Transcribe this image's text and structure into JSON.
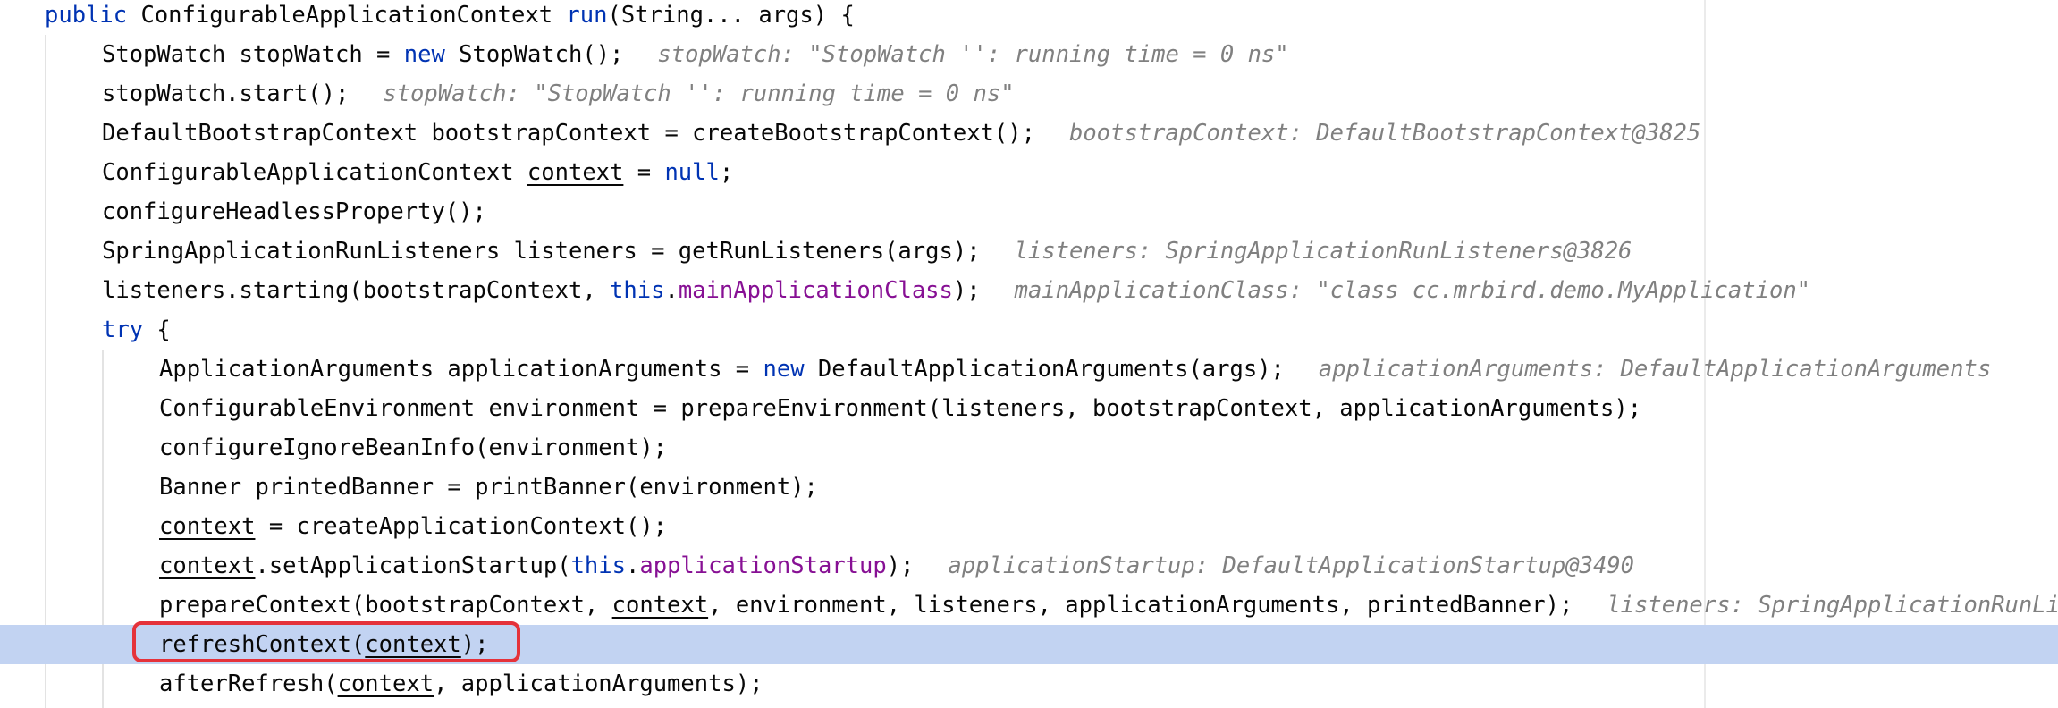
{
  "editor": {
    "lines": [
      {
        "indent": 0,
        "current": false,
        "tokens": [
          {
            "t": "public",
            "c": "kw"
          },
          {
            "t": " ConfigurableApplicationContext "
          },
          {
            "t": "run",
            "c": "kw"
          },
          {
            "t": "(String... args) {"
          }
        ],
        "hint": ""
      },
      {
        "indent": 1,
        "current": false,
        "tokens": [
          {
            "t": "StopWatch stopWatch = "
          },
          {
            "t": "new",
            "c": "kw"
          },
          {
            "t": " StopWatch();"
          }
        ],
        "hint": "stopWatch: \"StopWatch '': running time = 0 ns\""
      },
      {
        "indent": 1,
        "current": false,
        "tokens": [
          {
            "t": "stopWatch.start();"
          }
        ],
        "hint": "stopWatch: \"StopWatch '': running time = 0 ns\""
      },
      {
        "indent": 1,
        "current": false,
        "tokens": [
          {
            "t": "DefaultBootstrapContext bootstrapContext = createBootstrapContext();"
          }
        ],
        "hint": "bootstrapContext: DefaultBootstrapContext@3825"
      },
      {
        "indent": 1,
        "current": false,
        "tokens": [
          {
            "t": "ConfigurableApplicationContext "
          },
          {
            "t": "context",
            "c": "ul"
          },
          {
            "t": " = "
          },
          {
            "t": "null",
            "c": "kw"
          },
          {
            "t": ";"
          }
        ],
        "hint": ""
      },
      {
        "indent": 1,
        "current": false,
        "tokens": [
          {
            "t": "configureHeadlessProperty();"
          }
        ],
        "hint": ""
      },
      {
        "indent": 1,
        "current": false,
        "tokens": [
          {
            "t": "SpringApplicationRunListeners listeners = getRunListeners(args);"
          }
        ],
        "hint": "listeners: SpringApplicationRunListeners@3826"
      },
      {
        "indent": 1,
        "current": false,
        "tokens": [
          {
            "t": "listeners.starting(bootstrapContext, "
          },
          {
            "t": "this",
            "c": "kw"
          },
          {
            "t": "."
          },
          {
            "t": "mainApplicationClass",
            "c": "fld"
          },
          {
            "t": ");"
          }
        ],
        "hint": "mainApplicationClass: \"class cc.mrbird.demo.MyApplication\""
      },
      {
        "indent": 1,
        "current": false,
        "tokens": [
          {
            "t": "try",
            "c": "kw"
          },
          {
            "t": " {"
          }
        ],
        "hint": ""
      },
      {
        "indent": 2,
        "current": false,
        "tokens": [
          {
            "t": "ApplicationArguments applicationArguments = "
          },
          {
            "t": "new",
            "c": "kw"
          },
          {
            "t": " DefaultApplicationArguments(args);"
          }
        ],
        "hint": "applicationArguments: DefaultApplicationArguments"
      },
      {
        "indent": 2,
        "current": false,
        "tokens": [
          {
            "t": "ConfigurableEnvironment environment = prepareEnvironment(listeners, bootstrapContext, applicationArguments);"
          }
        ],
        "hint": ""
      },
      {
        "indent": 2,
        "current": false,
        "tokens": [
          {
            "t": "configureIgnoreBeanInfo(environment);"
          }
        ],
        "hint": ""
      },
      {
        "indent": 2,
        "current": false,
        "tokens": [
          {
            "t": "Banner printedBanner = printBanner(environment);"
          }
        ],
        "hint": ""
      },
      {
        "indent": 2,
        "current": false,
        "tokens": [
          {
            "t": "context",
            "c": "ul"
          },
          {
            "t": " = createApplicationContext();"
          }
        ],
        "hint": ""
      },
      {
        "indent": 2,
        "current": false,
        "tokens": [
          {
            "t": "context",
            "c": "ul"
          },
          {
            "t": ".setApplicationStartup("
          },
          {
            "t": "this",
            "c": "kw"
          },
          {
            "t": "."
          },
          {
            "t": "applicationStartup",
            "c": "fld"
          },
          {
            "t": ");"
          }
        ],
        "hint": "applicationStartup: DefaultApplicationStartup@3490"
      },
      {
        "indent": 2,
        "current": false,
        "tokens": [
          {
            "t": "prepareContext(bootstrapContext, "
          },
          {
            "t": "context",
            "c": "ul"
          },
          {
            "t": ", environment, listeners, applicationArguments, printedBanner);"
          }
        ],
        "hint": "listeners: SpringApplicationRunListeners"
      },
      {
        "indent": 2,
        "current": true,
        "tokens": [
          {
            "t": "refreshContext("
          },
          {
            "t": "context",
            "c": "ul"
          },
          {
            "t": ");"
          }
        ],
        "hint": ""
      },
      {
        "indent": 2,
        "current": false,
        "tokens": [
          {
            "t": "afterRefresh("
          },
          {
            "t": "context",
            "c": "ul"
          },
          {
            "t": ", applicationArguments);"
          }
        ],
        "hint": ""
      }
    ]
  }
}
